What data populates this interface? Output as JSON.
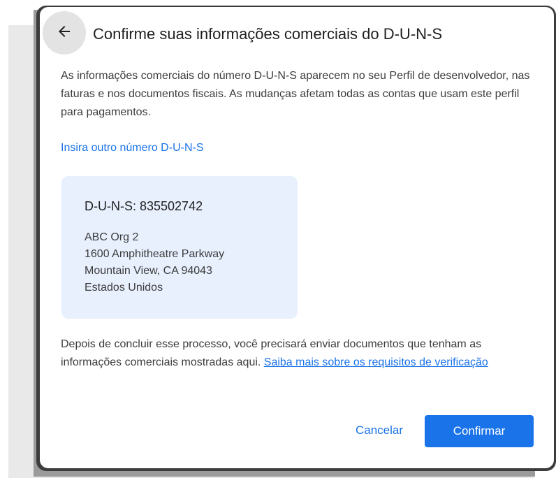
{
  "dialog": {
    "title": "Confirme suas informações comerciais do D-U-N-S",
    "back_icon": "arrow-back-icon",
    "description": "As informações comerciais do número D-U-N-S aparecem no seu Perfil de desenvolvedor, nas faturas e nos documentos fiscais. As mudanças afetam todas as contas que usam este perfil para pagamentos.",
    "alt_duns_link": "Insira outro número D-U-N-S",
    "duns_card": {
      "title": "D-U-N-S: 835502742",
      "address_lines": [
        "ABC Org 2",
        "1600 Amphitheatre Parkway",
        "Mountain View, CA 94043",
        "Estados Unidos"
      ]
    },
    "note_text": "Depois de concluir esse processo, você precisará enviar documentos que tenham as informações comerciais mostradas aqui. ",
    "note_link": "Saiba mais sobre os requisitos de verificação",
    "cancel_label": "Cancelar",
    "confirm_label": "Confirmar"
  },
  "colors": {
    "accent": "#1a73e8",
    "card_background": "#e8f0fe",
    "back_button_background": "#e3e3e3"
  }
}
